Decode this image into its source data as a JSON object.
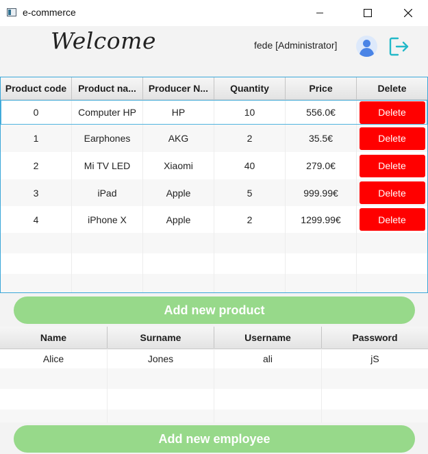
{
  "window": {
    "title": "e-commerce",
    "minimize": "—",
    "maximize": "☐",
    "close": "✕"
  },
  "header": {
    "welcome": "Welcome",
    "user": "fede [Administrator]"
  },
  "products": {
    "columns": [
      "Product code",
      "Product na...",
      "Producer N...",
      "Quantity",
      "Price",
      "Delete"
    ],
    "rows": [
      {
        "code": "0",
        "name": "Computer HP",
        "producer": "HP",
        "quantity": "10",
        "price": "556.0€",
        "delete": "Delete"
      },
      {
        "code": "1",
        "name": "Earphones",
        "producer": "AKG",
        "quantity": "2",
        "price": "35.5€",
        "delete": "Delete"
      },
      {
        "code": "2",
        "name": "Mi TV LED",
        "producer": "Xiaomi",
        "quantity": "40",
        "price": "279.0€",
        "delete": "Delete"
      },
      {
        "code": "3",
        "name": "iPad",
        "producer": "Apple",
        "quantity": "5",
        "price": "999.99€",
        "delete": "Delete"
      },
      {
        "code": "4",
        "name": "iPhone X",
        "producer": "Apple",
        "quantity": "2",
        "price": "1299.99€",
        "delete": "Delete"
      }
    ],
    "add_button": "Add new product"
  },
  "employees": {
    "columns": [
      "Name",
      "Surname",
      "Username",
      "Password"
    ],
    "rows": [
      {
        "name": "Alice",
        "surname": "Jones",
        "username": "ali",
        "password": "jS"
      }
    ],
    "add_button": "Add new employee"
  },
  "colors": {
    "delete": "#ff0000",
    "add_button": "#97d98a",
    "selection_border": "#39a6d8",
    "avatar": "#4a84e6",
    "logout": "#22b8c8"
  },
  "icons": {
    "app": "app-window-icon",
    "avatar": "user-avatar-icon",
    "logout": "logout-icon"
  }
}
